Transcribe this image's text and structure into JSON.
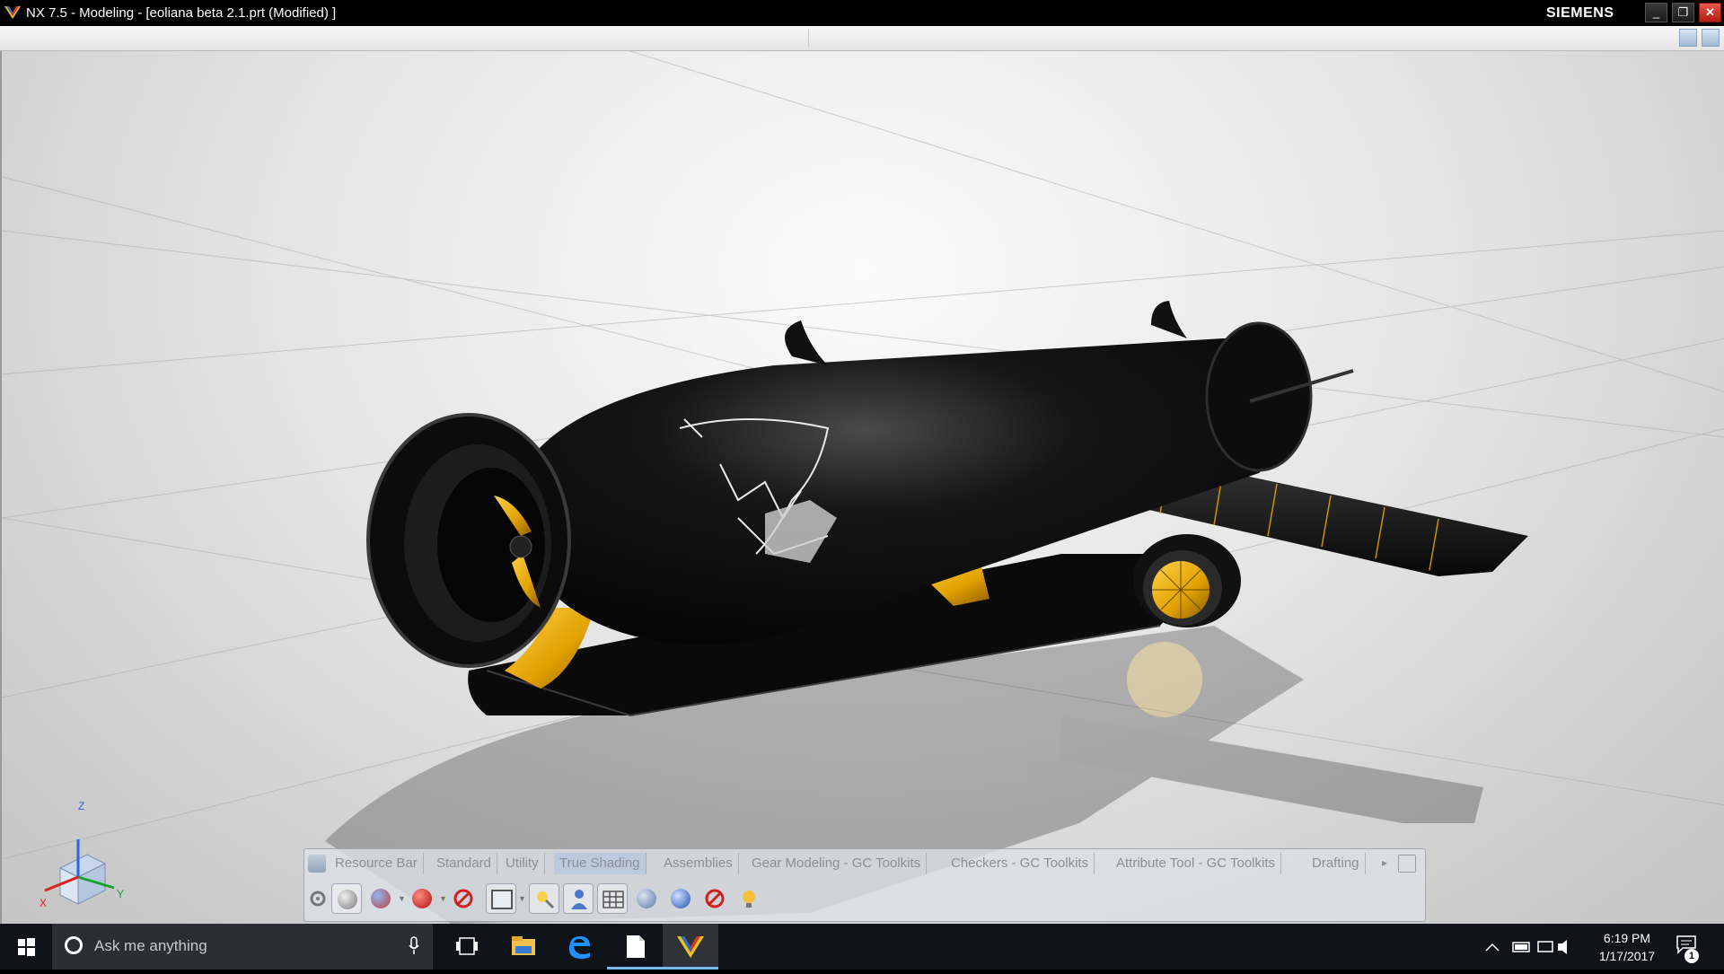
{
  "window": {
    "title": "NX 7.5 - Modeling - [eoliana beta 2.1.prt (Modified) ]",
    "brand": "SIEMENS",
    "controls": {
      "minimize": "_",
      "restore": "❐",
      "close": "✕"
    }
  },
  "toolbar": {
    "tabs": [
      {
        "label": "Resource Bar"
      },
      {
        "label": "Standard"
      },
      {
        "label": "Utility"
      },
      {
        "label": "True Shading"
      },
      {
        "label": "Assemblies"
      },
      {
        "label": "Gear Modeling - GC Toolkits"
      },
      {
        "label": "Checkers - GC Toolkits"
      },
      {
        "label": "Attribute Tool - GC Toolkits"
      },
      {
        "label": "Drafting"
      }
    ],
    "active_tab": "True Shading",
    "more_arrow": "▸",
    "tools": [
      "shading-sphere-icon",
      "material-sphere-icon",
      "red-sphere-icon",
      "no-symbol-icon",
      "background-frame-icon",
      "lamp-icon",
      "person-icon",
      "grid-floor-icon",
      "reflection-icon",
      "blue-sphere-icon",
      "no-shadow-icon",
      "spotlight-icon"
    ]
  },
  "triad": {
    "x": "X",
    "y": "Y",
    "z": "Z"
  },
  "taskbar": {
    "search_placeholder": "Ask me anything",
    "time": "6:19 PM",
    "date": "1/17/2017",
    "notification_count": "1",
    "pinned": [
      "task-view-icon",
      "file-explorer-icon",
      "edge-icon",
      "document-icon",
      "nx-app-icon"
    ]
  },
  "colors": {
    "accent_gold": "#f2b705",
    "body_black": "#0c0c0c",
    "taskbar_bg": "#101418",
    "close_red": "#d0321f"
  }
}
